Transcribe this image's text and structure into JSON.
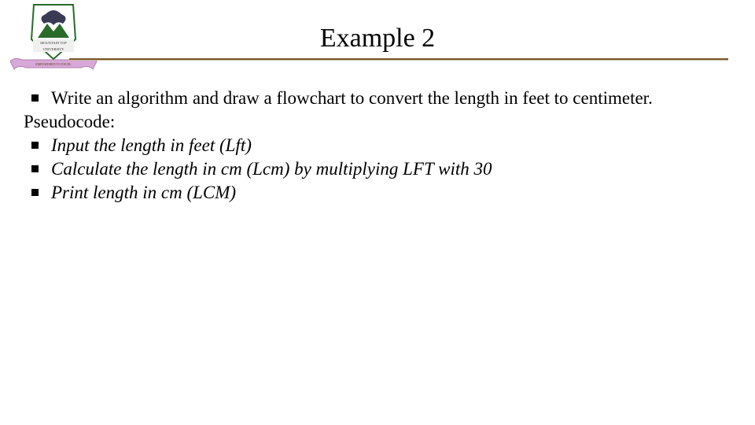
{
  "title": "Example 2",
  "logo": {
    "top_text": "MOUNTAIN TOP",
    "mid_text": "UNIVERSITY",
    "ribbon_text": "EMPOWERED TO EXCEL"
  },
  "content": {
    "intro": "Write an algorithm and draw a flowchart to convert the length in feet to centimeter.",
    "pseudocode_label": "Pseudocode:",
    "steps": [
      " Input the length in feet (Lft)",
      "Calculate the length in cm (Lcm) by multiplying LFT with 30",
      "Print length in cm (LCM)"
    ]
  }
}
